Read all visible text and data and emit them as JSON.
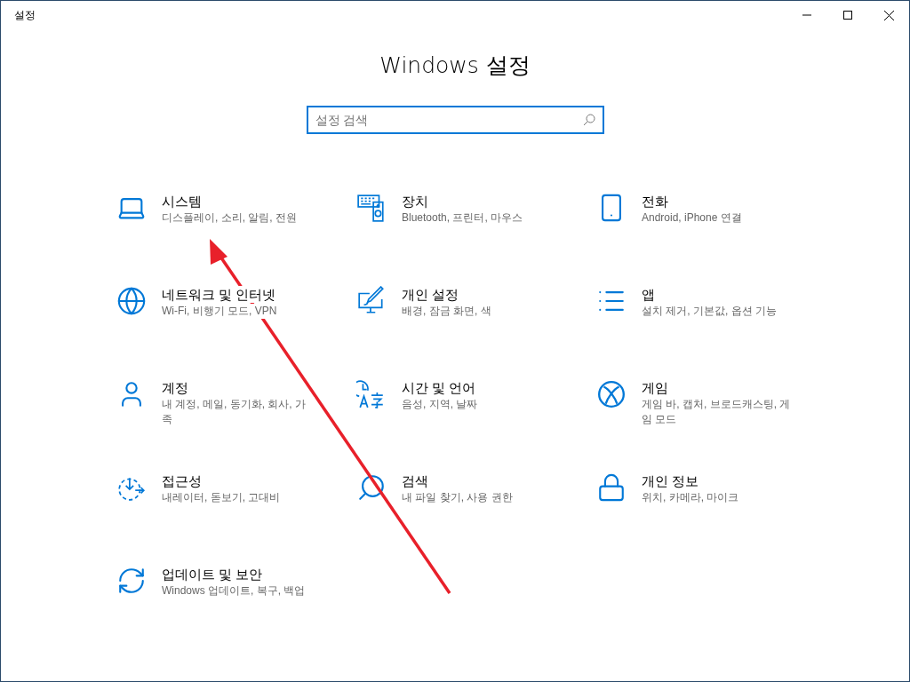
{
  "window": {
    "title": "설정"
  },
  "heading": "Windows 설정",
  "search": {
    "placeholder": "설정 검색"
  },
  "categories": [
    {
      "title": "시스템",
      "description": "디스플레이, 소리, 알림, 전원"
    },
    {
      "title": "장치",
      "description": "Bluetooth, 프린터, 마우스"
    },
    {
      "title": "전화",
      "description": "Android, iPhone 연결"
    },
    {
      "title": "네트워크 및 인터넷",
      "description": "Wi-Fi, 비행기 모드, VPN"
    },
    {
      "title": "개인 설정",
      "description": "배경, 잠금 화면, 색"
    },
    {
      "title": "앱",
      "description": "설치 제거, 기본값, 옵션 기능"
    },
    {
      "title": "계정",
      "description": "내 계정, 메일, 동기화, 회사, 가족"
    },
    {
      "title": "시간 및 언어",
      "description": "음성, 지역, 날짜"
    },
    {
      "title": "게임",
      "description": "게임 바, 캡처, 브로드캐스팅, 게임 모드"
    },
    {
      "title": "접근성",
      "description": "내레이터, 돋보기, 고대비"
    },
    {
      "title": "검색",
      "description": "내 파일 찾기, 사용 권한"
    },
    {
      "title": "개인 정보",
      "description": "위치, 카메라, 마이크"
    },
    {
      "title": "업데이트 및 보안",
      "description": "Windows 업데이트, 복구, 백업"
    }
  ]
}
